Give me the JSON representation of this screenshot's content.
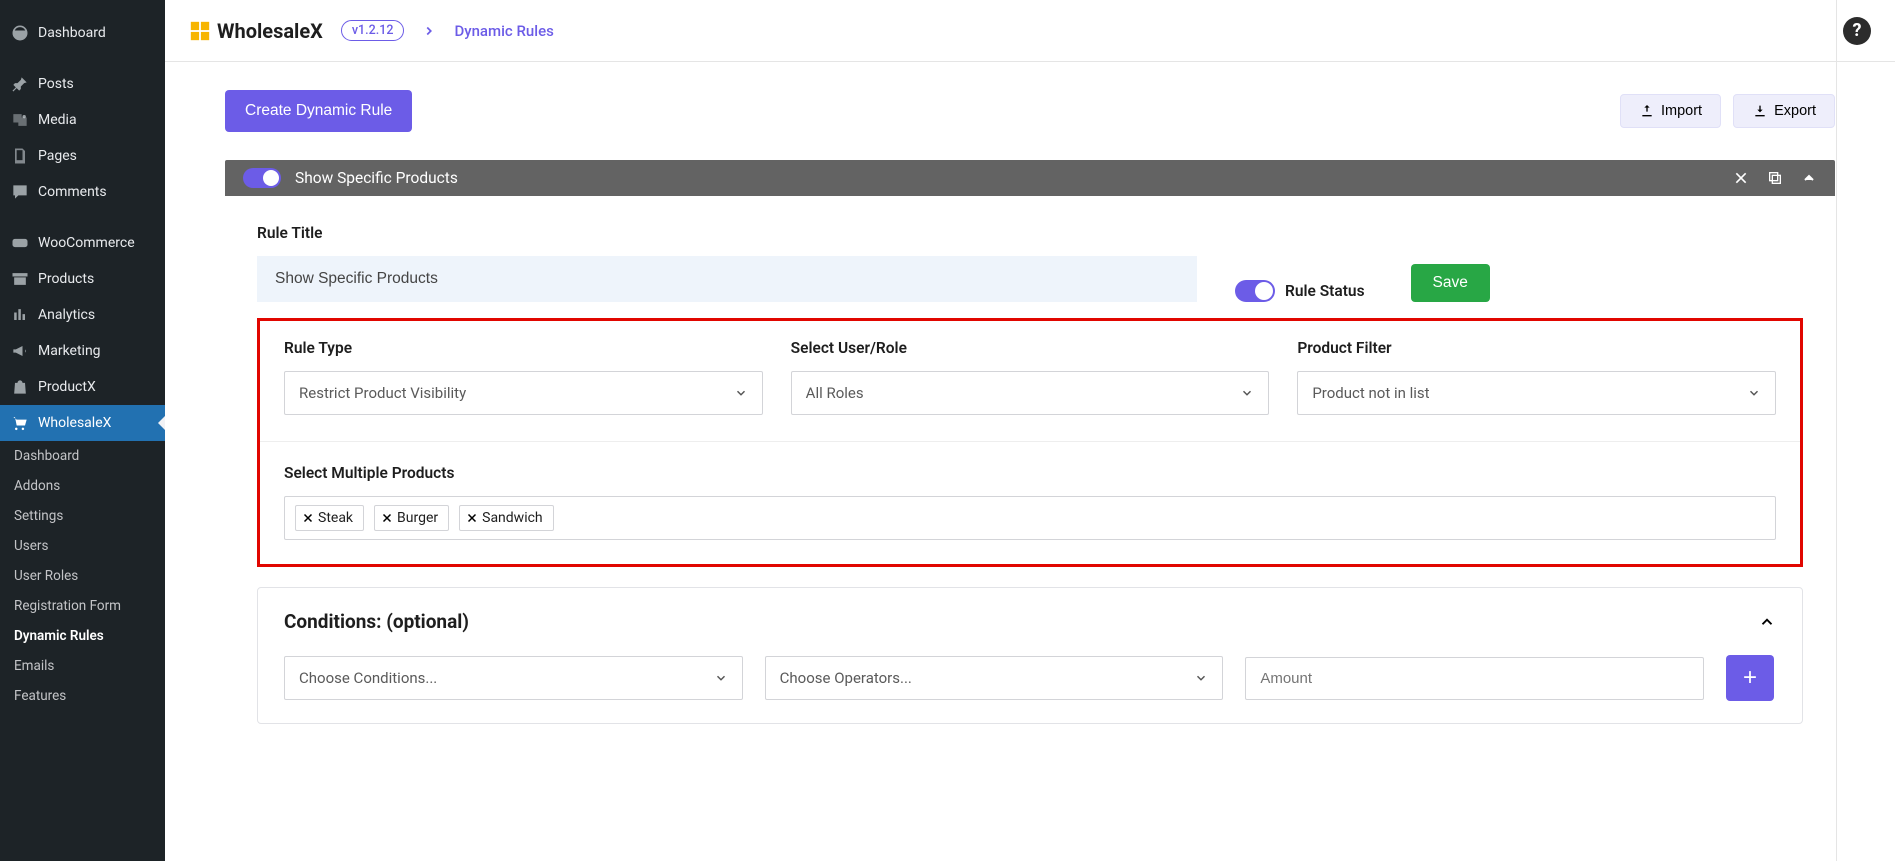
{
  "sidebar": {
    "items": [
      {
        "label": "Dashboard"
      },
      {
        "label": "Posts"
      },
      {
        "label": "Media"
      },
      {
        "label": "Pages"
      },
      {
        "label": "Comments"
      },
      {
        "label": "WooCommerce"
      },
      {
        "label": "Products"
      },
      {
        "label": "Analytics"
      },
      {
        "label": "Marketing"
      },
      {
        "label": "ProductX"
      },
      {
        "label": "WholesaleX"
      }
    ],
    "sub": [
      {
        "label": "Dashboard"
      },
      {
        "label": "Addons"
      },
      {
        "label": "Settings"
      },
      {
        "label": "Users"
      },
      {
        "label": "User Roles"
      },
      {
        "label": "Registration Form"
      },
      {
        "label": "Dynamic Rules"
      },
      {
        "label": "Emails"
      },
      {
        "label": "Features"
      }
    ]
  },
  "topbar": {
    "brand": "WholesaleX",
    "version": "v1.2.12",
    "breadcrumb": "Dynamic Rules"
  },
  "page": {
    "create_btn": "Create Dynamic Rule",
    "import_btn": "Import",
    "export_btn": "Export"
  },
  "rule": {
    "header_title": "Show Specific Products",
    "title_label": "Rule Title",
    "title_value": "Show Specific Products",
    "status_label": "Rule Status",
    "save_btn": "Save",
    "type_label": "Rule Type",
    "type_value": "Restrict Product Visibility",
    "role_label": "Select User/Role",
    "role_value": "All Roles",
    "filter_label": "Product Filter",
    "filter_value": "Product not in list",
    "products_label": "Select Multiple Products",
    "tags": [
      "Steak",
      "Burger",
      "Sandwich"
    ]
  },
  "conditions": {
    "title": "Conditions: (optional)",
    "cond_placeholder": "Choose Conditions...",
    "op_placeholder": "Choose Operators...",
    "amount_placeholder": "Amount"
  }
}
